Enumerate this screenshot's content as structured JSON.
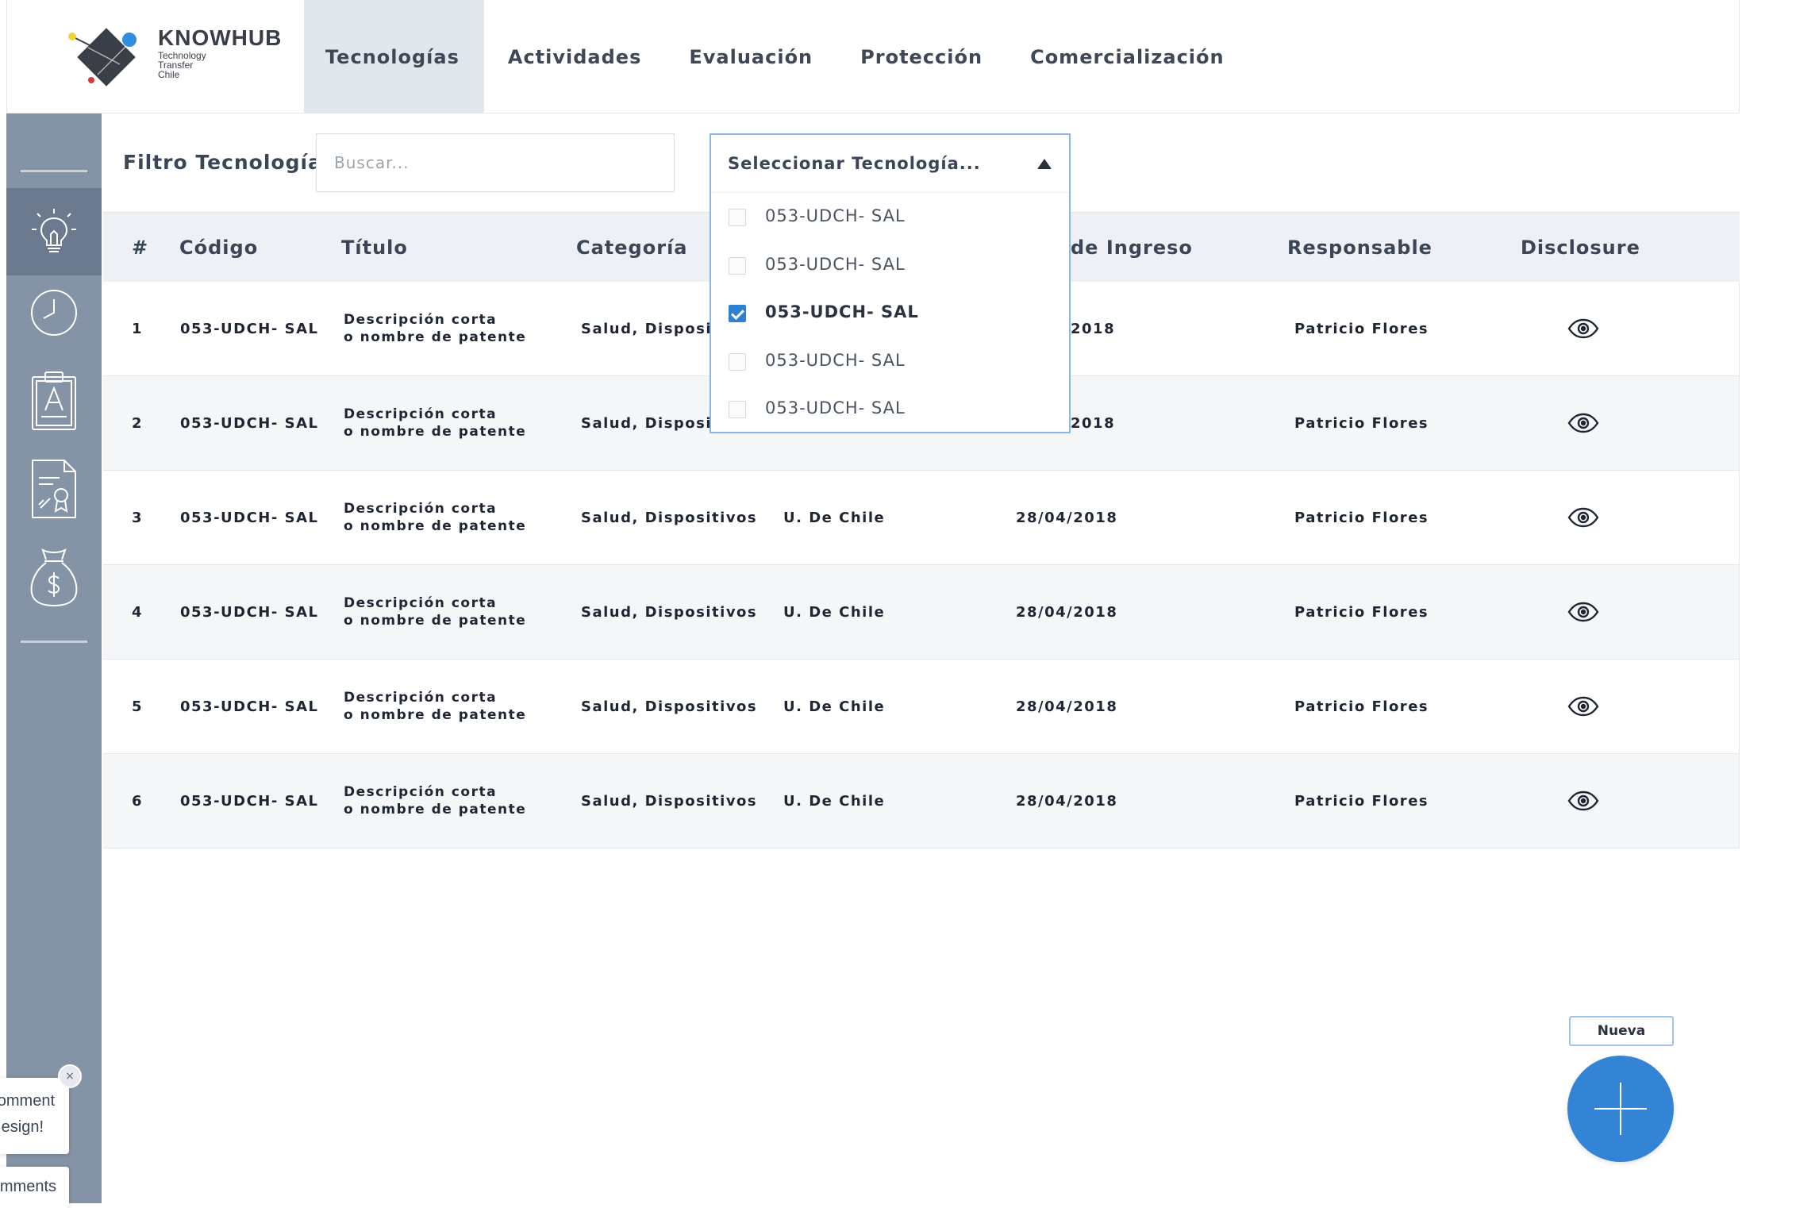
{
  "brand": {
    "name_bold_a": "KNOW",
    "name_bold_b": "HUB",
    "tagline": [
      "Technology",
      "Transfer",
      "Chile"
    ]
  },
  "nav": {
    "items": [
      {
        "label": "Tecnologías",
        "active": true
      },
      {
        "label": "Actividades",
        "active": false
      },
      {
        "label": "Evaluación",
        "active": false
      },
      {
        "label": "Protección",
        "active": false
      },
      {
        "label": "Comercialización",
        "active": false
      }
    ]
  },
  "sidebar": {
    "items": [
      {
        "icon": "lightbulb-icon",
        "active": true
      },
      {
        "icon": "clock-icon",
        "active": false
      },
      {
        "icon": "clipboard-icon",
        "active": false
      },
      {
        "icon": "certificate-document-icon",
        "active": false
      },
      {
        "icon": "money-bag-icon",
        "active": false
      }
    ]
  },
  "filter": {
    "label": "Filtro Tecnologías",
    "search_placeholder": "Buscar...",
    "search_value": ""
  },
  "dropdown": {
    "placeholder": "Seleccionar Tecnología...",
    "open": true,
    "options": [
      {
        "label": "053-UDCH- SAL",
        "checked": false
      },
      {
        "label": "053-UDCH- SAL",
        "checked": false
      },
      {
        "label": "053-UDCH- SAL",
        "checked": true
      },
      {
        "label": "053-UDCH- SAL",
        "checked": false
      },
      {
        "label": "053-UDCH- SAL",
        "checked": false
      }
    ]
  },
  "table": {
    "headers": {
      "num": "#",
      "codigo": "Código",
      "titulo": "Título",
      "categoria": "Categoría",
      "ingreso": "de Ingreso",
      "responsable": "Responsable",
      "disclosure": "Disclosure"
    },
    "rows": [
      {
        "num": "1",
        "codigo": "053-UDCH- SAL",
        "titulo_1": "Descripción corta",
        "titulo_2": "o nombre de patente",
        "categoria": "Salud, Dispositiv",
        "institucion": "",
        "fecha": "2018",
        "responsable": "Patricio Flores"
      },
      {
        "num": "2",
        "codigo": "053-UDCH- SAL",
        "titulo_1": "Descripción corta",
        "titulo_2": "o nombre de patente",
        "categoria": "Salud, Dispositiv",
        "institucion": "",
        "fecha": "2018",
        "responsable": "Patricio Flores"
      },
      {
        "num": "3",
        "codigo": "053-UDCH- SAL",
        "titulo_1": "Descripción corta",
        "titulo_2": "o nombre de patente",
        "categoria": "Salud, Dispositivos",
        "institucion": "U. De Chile",
        "fecha": "28/04/2018",
        "responsable": "Patricio Flores"
      },
      {
        "num": "4",
        "codigo": "053-UDCH- SAL",
        "titulo_1": "Descripción corta",
        "titulo_2": "o nombre de patente",
        "categoria": "Salud, Dispositivos",
        "institucion": "U. De Chile",
        "fecha": "28/04/2018",
        "responsable": "Patricio Flores"
      },
      {
        "num": "5",
        "codigo": "053-UDCH- SAL",
        "titulo_1": "Descripción corta",
        "titulo_2": "o nombre de patente",
        "categoria": "Salud, Dispositivos",
        "institucion": "U. De Chile",
        "fecha": "28/04/2018",
        "responsable": "Patricio Flores"
      },
      {
        "num": "6",
        "codigo": "053-UDCH- SAL",
        "titulo_1": "Descripción corta",
        "titulo_2": "o nombre de patente",
        "categoria": "Salud, Dispositivos",
        "institucion": "U. De Chile",
        "fecha": "28/04/2018",
        "responsable": "Patricio Flores"
      }
    ]
  },
  "fab": {
    "tooltip": "Nueva",
    "icon": "plus-icon"
  },
  "comments": {
    "card_line1": "omment",
    "card_line2": "esign!",
    "button_label": "mments",
    "close_glyph": "×"
  },
  "colors": {
    "accent": "#3484d6",
    "sidebar": "#8593a6",
    "sidebar_active": "#6b7a8f",
    "header_bg": "#edf0f5"
  }
}
